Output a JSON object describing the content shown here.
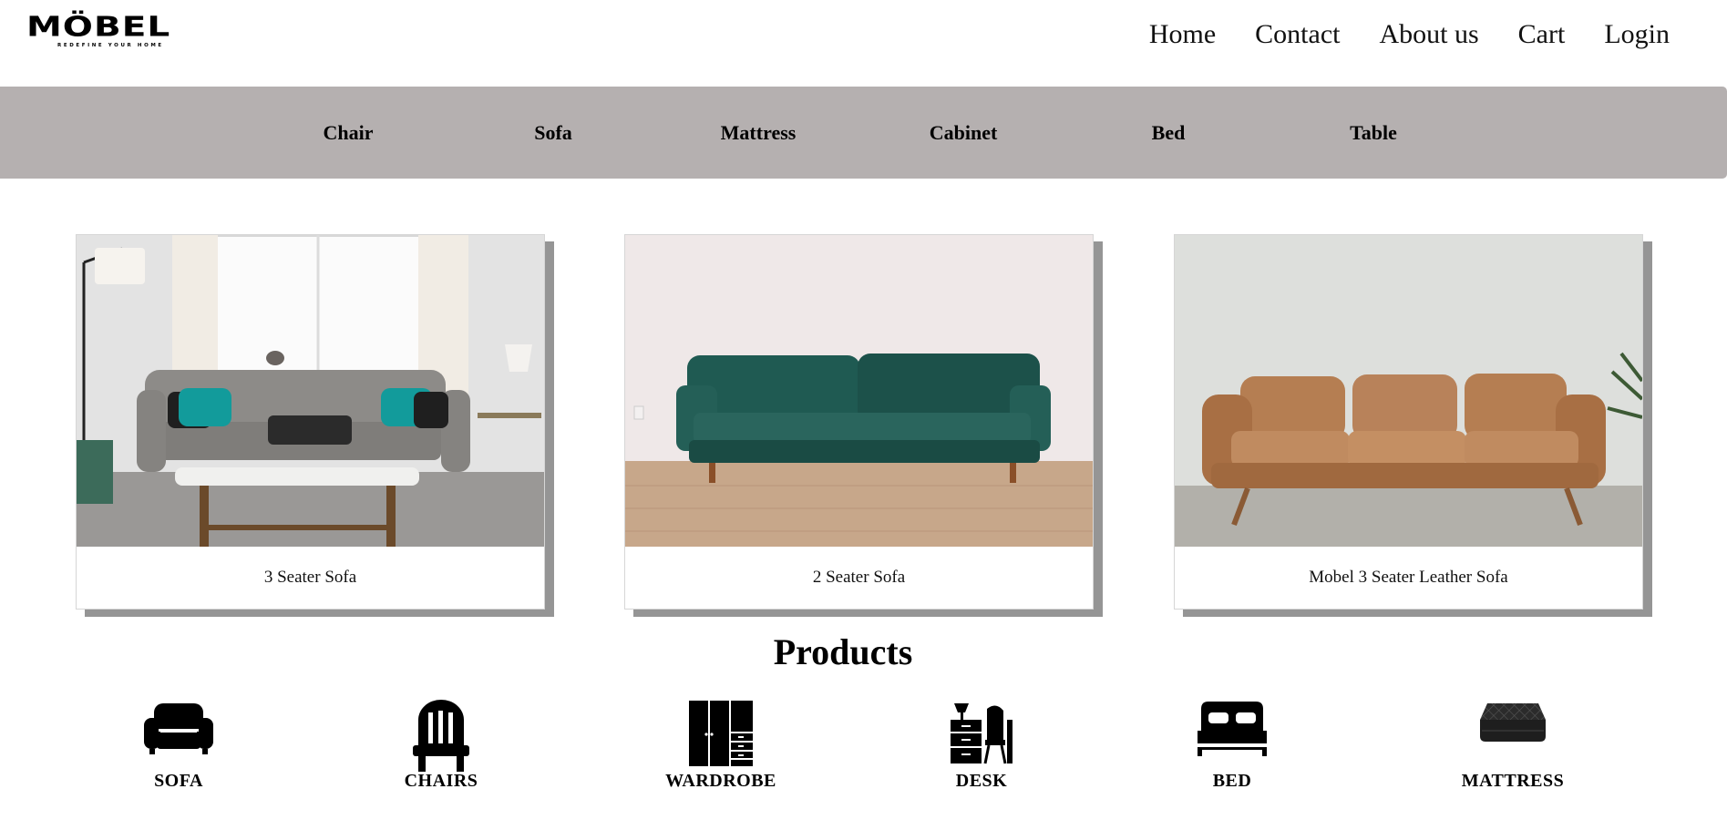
{
  "brand": {
    "name": "MÖBEL",
    "tagline": "REDEFINE YOUR HOME"
  },
  "nav": {
    "items": [
      "Home",
      "Contact",
      "About us",
      "Cart",
      "Login"
    ]
  },
  "categories": [
    "Chair",
    "Sofa",
    "Mattress",
    "Cabinet",
    "Bed",
    "Table"
  ],
  "cards": [
    {
      "caption": "3 Seater Sofa"
    },
    {
      "caption": "2 Seater Sofa"
    },
    {
      "caption": "Mobel 3 Seater Leather Sofa"
    }
  ],
  "products": {
    "title": "Products",
    "items": [
      {
        "label": "SOFA",
        "icon": "sofa-icon"
      },
      {
        "label": "CHAIRS",
        "icon": "chair-icon"
      },
      {
        "label": "WARDROBE",
        "icon": "wardrobe-icon"
      },
      {
        "label": "DESK",
        "icon": "desk-icon"
      },
      {
        "label": "BED",
        "icon": "bed-icon"
      },
      {
        "label": "MATTRESS",
        "icon": "mattress-icon"
      }
    ]
  }
}
